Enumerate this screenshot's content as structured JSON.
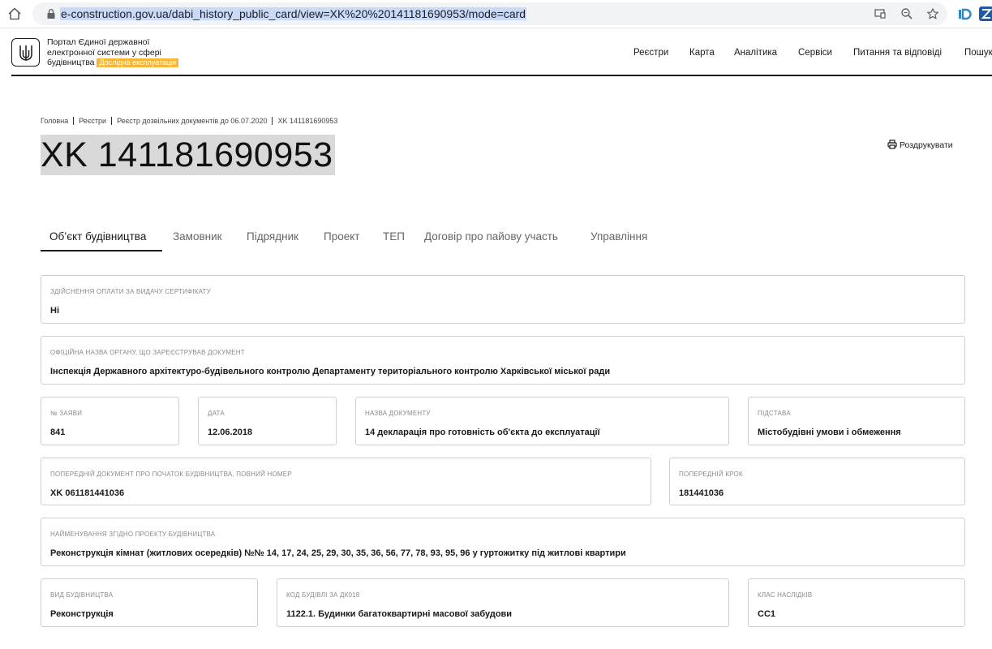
{
  "browser": {
    "url": "e-construction.gov.ua/dabi_history_public_card/view=XK%20%20141181690953/mode=card"
  },
  "header": {
    "portal_name_line1": "Портал Єдиної державної",
    "portal_name_line2": "електронної системи у сфері",
    "portal_name_line3": "будівництва",
    "badge": "Дослідна експлуатація",
    "nav": [
      "Реєстри",
      "Карта",
      "Аналітика",
      "Сервіси",
      "Питання та відповіді",
      "Пошук"
    ]
  },
  "breadcrumb": [
    "Головна",
    "Реєстри",
    "Реєстр дозвільних документів до 06.07.2020",
    "XK 141181690953"
  ],
  "page": {
    "title": "XK 141181690953",
    "print_label": "Роздрукувати"
  },
  "tabs": [
    "Об’єкт будівництва",
    "Замовник",
    "Підрядник",
    "Проект",
    "ТЕП",
    "Договір про пайову участь",
    "Управління"
  ],
  "fields": {
    "payment": {
      "label": "Здійснення оплати за видачу сертифікату",
      "value": "Ні"
    },
    "authority": {
      "label": "Офіційна назва органу, що зареєстрував документ",
      "value": "Інспекція Державного архітектуро-будівельного контролю Департаменту територіального контролю Харківської міської ради"
    },
    "application_no": {
      "label": "№ заяви",
      "value": "841"
    },
    "date": {
      "label": "Дата",
      "value": "12.06.2018"
    },
    "doc_name": {
      "label": "Назва документу",
      "value": "14 декларація про готовність об'єкта до експлуатації"
    },
    "basis": {
      "label": "Підстава",
      "value": "Містобудівні умови і обмеження"
    },
    "prev_doc": {
      "label": "Попередній документ про початок будівництва, повний номер",
      "value": "XK 061181441036"
    },
    "prev_step": {
      "label": "Попередній крок",
      "value": "181441036"
    },
    "project_name": {
      "label": "Найменування згідно проекту будівництва",
      "value": "Реконструкція кімнат (житлових осередків) №№ 14, 17, 24, 25, 29, 30, 35, 36, 56, 77, 78, 93, 95, 96 у гуртожитку під житлові квартири"
    },
    "construction_type": {
      "label": "Вид будівництва",
      "value": "Реконструкція"
    },
    "building_code": {
      "label": "Код будівлі за ДК018",
      "value": "1122.1. Будинки багатоквартирні масової забудови"
    },
    "consequence_class": {
      "label": "Клас наслідків",
      "value": "СС1"
    }
  },
  "colors": {
    "badge": "#f5b73a",
    "url_highlight": "#c9d9f7",
    "title_highlight": "#d9d9d9"
  },
  "icons": [
    "home-icon",
    "lock-icon",
    "cast-icon",
    "zoom-icon",
    "star-icon",
    "extension-id-icon",
    "extension-z-icon",
    "trident-icon",
    "printer-icon"
  ]
}
